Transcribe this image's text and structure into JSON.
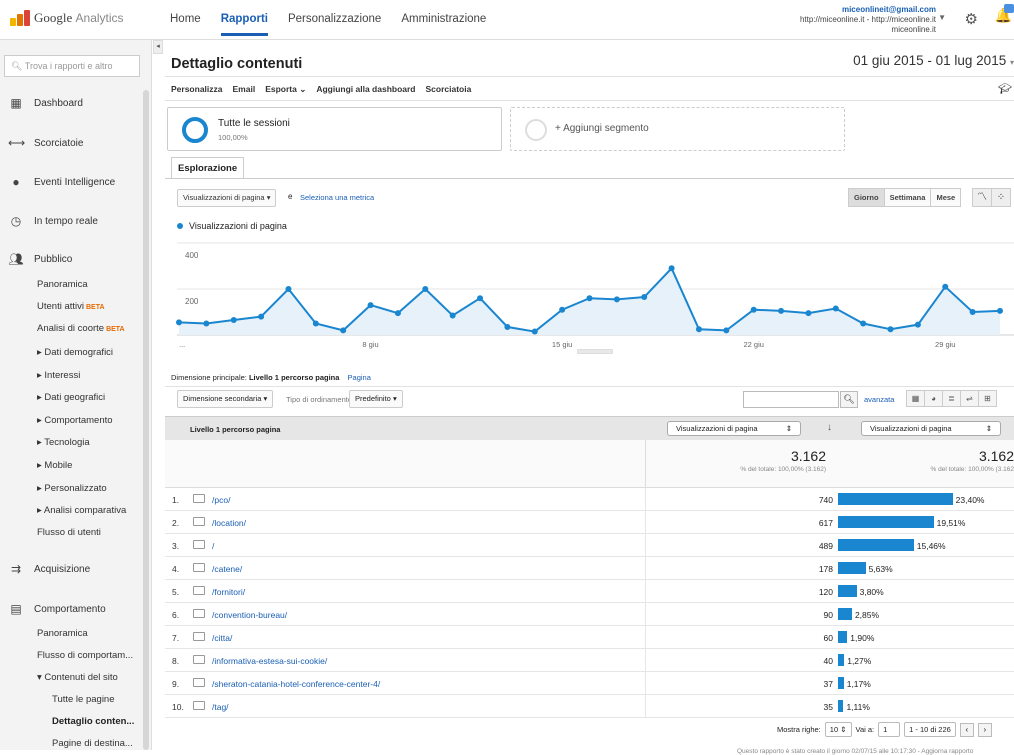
{
  "app": {
    "brand_google": "Google",
    "brand_analytics": "Analytics"
  },
  "topnav": {
    "items": [
      "Home",
      "Rapporti",
      "Personalizzazione",
      "Amministrazione"
    ],
    "active": "Rapporti"
  },
  "account": {
    "email": "miceonlineit@gmail.com",
    "property": "http://miceonline.it - http://miceonline.it",
    "view": "miceonline.it"
  },
  "sidebar": {
    "search_placeholder": "Trova i rapporti e altro",
    "sections": [
      {
        "label": "Dashboard",
        "icon": "dashboard-icon"
      },
      {
        "label": "Scorciatoie",
        "icon": "shortcut-icon"
      },
      {
        "label": "Eventi Intelligence",
        "icon": "lightbulb-icon"
      },
      {
        "label": "In tempo reale",
        "icon": "clock-icon"
      },
      {
        "label": "Pubblico",
        "icon": "people-icon"
      },
      {
        "label": "Acquisizione",
        "icon": "acquisition-icon"
      },
      {
        "label": "Comportamento",
        "icon": "behavior-icon"
      }
    ],
    "pubblico_items": [
      "Panoramica",
      "Utenti attivi",
      "Analisi di coorte",
      "▸ Dati demografici",
      "▸ Interessi",
      "▸ Dati geografici",
      "▸ Comportamento",
      "▸ Tecnologia",
      "▸ Mobile",
      "▸ Personalizzato",
      "▸ Analisi comparativa",
      "Flusso di utenti"
    ],
    "beta_label": "BETA",
    "comportamento_items": [
      "Panoramica",
      "Flusso di comportam...",
      "▾ Contenuti del sito",
      "Tutte le pagine",
      "Dettaglio conten...",
      "Pagine di destina..."
    ]
  },
  "main": {
    "title": "Dettaglio contenuti",
    "date_range": "01 giu 2015 - 01 lug 2015",
    "actions": [
      "Personalizza",
      "Email",
      "Esporta ⌄",
      "Aggiungi alla dashboard",
      "Scorciatoia"
    ],
    "segment1_title": "Tutte le sessioni",
    "segment1_pct": "100,00%",
    "segment2_title": "+ Aggiungi segmento",
    "tab": "Esplorazione",
    "metric_select": "Visualizzazioni di pagina",
    "metric_and": "e",
    "metric_link": "Seleziona una metrica",
    "granularity": [
      "Giorno",
      "Settimana",
      "Mese"
    ],
    "granularity_active": "Giorno",
    "legend": "Visualizzazioni di pagina"
  },
  "chart_data": {
    "type": "line",
    "series": [
      {
        "name": "Visualizzazioni di pagina",
        "values": [
          55,
          50,
          65,
          80,
          200,
          50,
          20,
          130,
          95,
          200,
          85,
          160,
          35,
          15,
          110,
          160,
          155,
          165,
          290,
          25,
          20,
          110,
          105,
          95,
          115,
          50,
          25,
          45,
          210,
          100,
          105
        ]
      }
    ],
    "x": [
      "1 giu",
      "2 giu",
      "3 giu",
      "4 giu",
      "5 giu",
      "6 giu",
      "7 giu",
      "8 giu",
      "9 giu",
      "10 giu",
      "11 giu",
      "12 giu",
      "13 giu",
      "14 giu",
      "15 giu",
      "16 giu",
      "17 giu",
      "18 giu",
      "19 giu",
      "20 giu",
      "21 giu",
      "22 giu",
      "23 giu",
      "24 giu",
      "25 giu",
      "26 giu",
      "27 giu",
      "28 giu",
      "29 giu",
      "30 giu",
      "1 lug"
    ],
    "y_ticks": [
      "400",
      "200"
    ],
    "x_ticks": [
      "...",
      "8 giu",
      "15 giu",
      "22 giu",
      "29 giu"
    ],
    "ylim": [
      0,
      400
    ],
    "color": "#1a86d0",
    "fill": "#e7f1f9"
  },
  "table": {
    "primary_dim_label": "Dimensione principale:",
    "primary_dim_value": "Livello 1 percorso pagina",
    "primary_dim_alt": "Pagina",
    "secondary_dim": "Dimensione secondaria",
    "sort_label": "Tipo di ordinamento:",
    "sort_value": "Predefinito",
    "advanced": "avanzata",
    "col1": "Livello 1 percorso pagina",
    "col2_select": "Visualizzazioni di pagina",
    "col3_select": "Visualizzazioni di pagina",
    "total_value": "3.162",
    "total_value2": "3.162",
    "total_note": "% del totale: 100,00% (3.162)",
    "total_note2": "% del totale: 100,00% (3.162",
    "rows": [
      {
        "n": "1.",
        "path": "/pco/",
        "value": "740",
        "pct": "23,40%",
        "share": 23.4
      },
      {
        "n": "2.",
        "path": "/location/",
        "value": "617",
        "pct": "19,51%",
        "share": 19.51
      },
      {
        "n": "3.",
        "path": "/",
        "value": "489",
        "pct": "15,46%",
        "share": 15.46
      },
      {
        "n": "4.",
        "path": "/catene/",
        "value": "178",
        "pct": "5,63%",
        "share": 5.63
      },
      {
        "n": "5.",
        "path": "/fornitori/",
        "value": "120",
        "pct": "3,80%",
        "share": 3.8
      },
      {
        "n": "6.",
        "path": "/convention-bureau/",
        "value": "90",
        "pct": "2,85%",
        "share": 2.85
      },
      {
        "n": "7.",
        "path": "/citta/",
        "value": "60",
        "pct": "1,90%",
        "share": 1.9
      },
      {
        "n": "8.",
        "path": "/informativa-estesa-sui-cookie/",
        "value": "40",
        "pct": "1,27%",
        "share": 1.27
      },
      {
        "n": "9.",
        "path": "/sheraton-catania-hotel-conference-center-4/",
        "value": "37",
        "pct": "1,17%",
        "share": 1.17
      },
      {
        "n": "10.",
        "path": "/tag/",
        "value": "35",
        "pct": "1,11%",
        "share": 1.11
      }
    ],
    "show_rows_label": "Mostra righe:",
    "show_rows_value": "10",
    "goto_label": "Vai a:",
    "goto_value": "1",
    "range": "1 - 10 di 226",
    "footnote": "Questo rapporto è stato creato il giorno 02/07/15 alle 10:17:30 - Aggiorna rapporto"
  }
}
